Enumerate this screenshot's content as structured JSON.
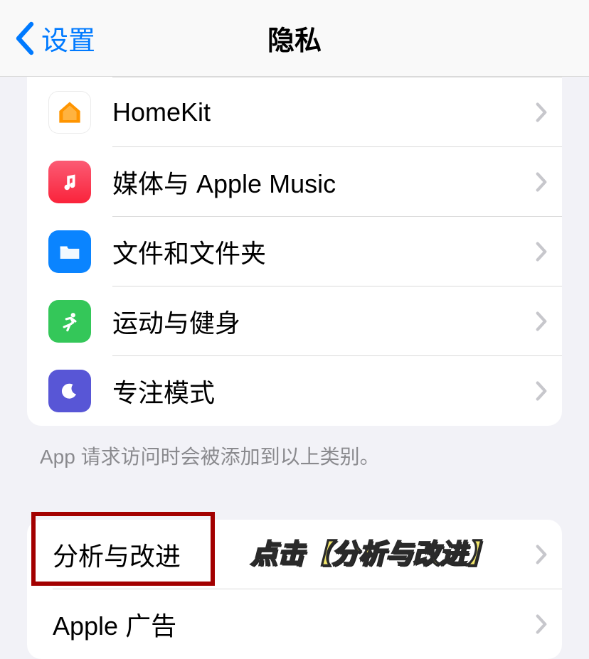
{
  "nav": {
    "back_label": "设置",
    "title": "隐私"
  },
  "group1": {
    "items": [
      {
        "label": "HomeKit",
        "icon": "homekit"
      },
      {
        "label": "媒体与 Apple Music",
        "icon": "music"
      },
      {
        "label": "文件和文件夹",
        "icon": "files"
      },
      {
        "label": "运动与健身",
        "icon": "fitness"
      },
      {
        "label": "专注模式",
        "icon": "focus"
      }
    ],
    "footer": "App 请求访问时会被添加到以上类别。"
  },
  "group2": {
    "items": [
      {
        "label": "分析与改进"
      },
      {
        "label": "Apple 广告"
      }
    ]
  },
  "annotation": {
    "text": "点击【分析与改进】"
  }
}
